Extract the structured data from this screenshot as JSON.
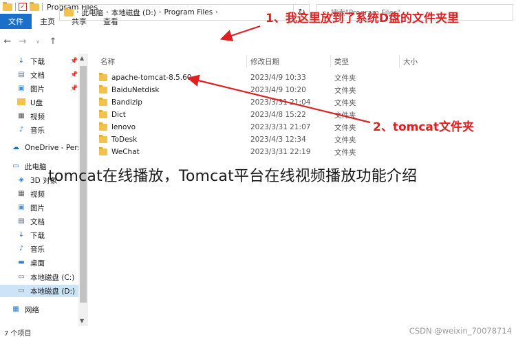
{
  "window": {
    "title": "Program Files"
  },
  "ribbon": {
    "tabs": [
      "文件",
      "主页",
      "共享",
      "查看"
    ]
  },
  "address": {
    "crumbs": [
      "此电脑",
      "本地磁盘 (D:)",
      "Program Files"
    ],
    "search_placeholder": "搜索\"Program Files\""
  },
  "sidebar": {
    "items": [
      {
        "label": "下载",
        "icon": "download-icon",
        "pinned": true
      },
      {
        "label": "文档",
        "icon": "document-icon",
        "pinned": true
      },
      {
        "label": "图片",
        "icon": "picture-icon",
        "pinned": true
      },
      {
        "label": "U盘",
        "icon": "folder-icon",
        "pinned": false
      },
      {
        "label": "视频",
        "icon": "video-icon",
        "pinned": false
      },
      {
        "label": "音乐",
        "icon": "music-icon",
        "pinned": false
      },
      {
        "label": "OneDrive - Perso",
        "icon": "cloud-icon",
        "pinned": false
      },
      {
        "label": "此电脑",
        "icon": "computer-icon",
        "pinned": false
      },
      {
        "label": "3D 对象",
        "icon": "cube-icon",
        "pinned": false
      },
      {
        "label": "视频",
        "icon": "video-icon",
        "pinned": false
      },
      {
        "label": "图片",
        "icon": "picture-icon",
        "pinned": false
      },
      {
        "label": "文档",
        "icon": "document-icon",
        "pinned": false
      },
      {
        "label": "下载",
        "icon": "download-icon",
        "pinned": false
      },
      {
        "label": "音乐",
        "icon": "music-icon",
        "pinned": false
      },
      {
        "label": "桌面",
        "icon": "desktop-icon",
        "pinned": false
      },
      {
        "label": "本地磁盘 (C:)",
        "icon": "drive-icon",
        "pinned": false
      },
      {
        "label": "本地磁盘 (D:)",
        "icon": "drive-icon",
        "pinned": false
      },
      {
        "label": "网络",
        "icon": "network-icon",
        "pinned": false
      }
    ]
  },
  "columns": {
    "name": "名称",
    "date": "修改日期",
    "type": "类型",
    "size": "大小"
  },
  "files": [
    {
      "name": "apache-tomcat-8.5.60",
      "date": "2023/4/9 10:33",
      "type": "文件夹"
    },
    {
      "name": "BaiduNetdisk",
      "date": "2023/4/9 10:20",
      "type": "文件夹"
    },
    {
      "name": "Bandizip",
      "date": "2023/3/31 21:04",
      "type": "文件夹"
    },
    {
      "name": "Dict",
      "date": "2023/4/8 15:22",
      "type": "文件夹"
    },
    {
      "name": "lenovo",
      "date": "2023/3/31 21:07",
      "type": "文件夹"
    },
    {
      "name": "ToDesk",
      "date": "2023/4/3 12:34",
      "type": "文件夹"
    },
    {
      "name": "WeChat",
      "date": "2023/3/31 22:19",
      "type": "文件夹"
    }
  ],
  "annotations": {
    "note1": "1、我这里放到了系统D盘的文件夹里",
    "note2": "2、tomcat文件夹",
    "color": "#e02020"
  },
  "overlay_caption": "tomcat在线播放，Tomcat平台在线视频播放功能介绍",
  "status": {
    "count": "7 个项目"
  },
  "watermark": "CSDN @weixin_70078714"
}
